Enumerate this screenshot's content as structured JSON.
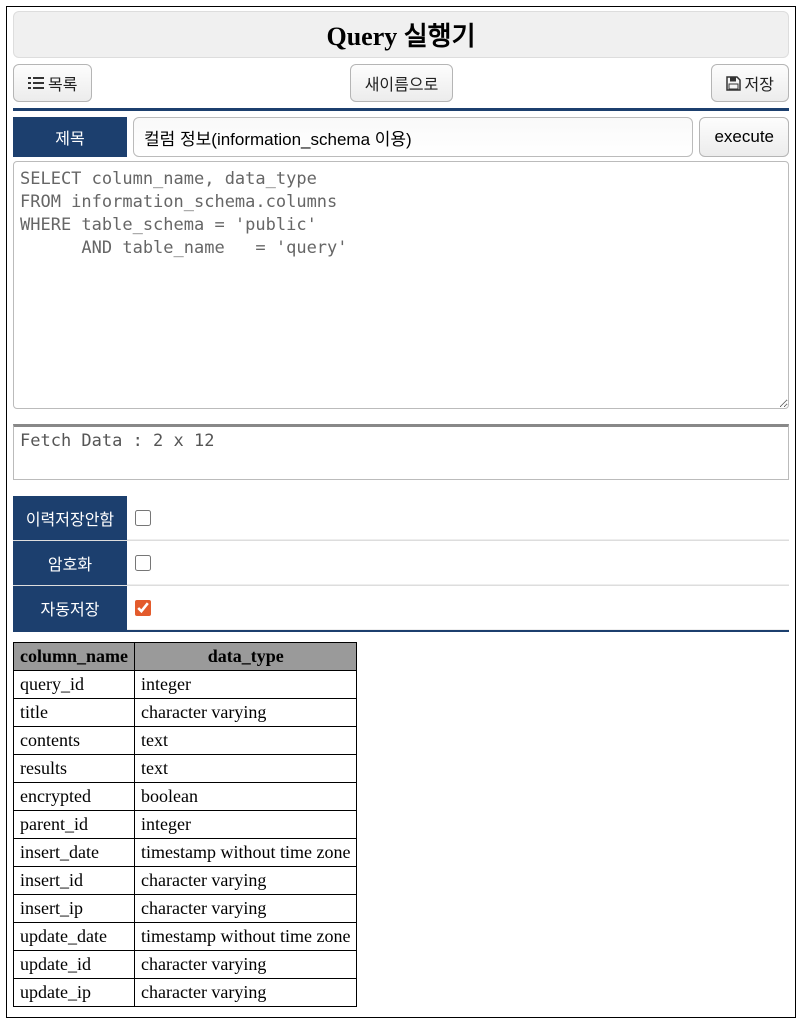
{
  "header": {
    "title": "Query 실행기"
  },
  "toolbar": {
    "list_label": "목록",
    "saveas_label": "새이름으로",
    "save_label": "저장"
  },
  "title_row": {
    "label": "제목",
    "value": "컬럼 정보(information_schema 이용)",
    "execute_label": "execute"
  },
  "query": "SELECT column_name, data_type\nFROM information_schema.columns\nWHERE table_schema = 'public'\n      AND table_name   = 'query'",
  "status": "Fetch Data : 2 x 12",
  "options": {
    "no_history": {
      "label": "이력저장안함",
      "checked": false
    },
    "encrypt": {
      "label": "암호화",
      "checked": false
    },
    "autosave": {
      "label": "자동저장",
      "checked": true
    }
  },
  "result": {
    "headers": [
      "column_name",
      "data_type"
    ],
    "rows": [
      [
        "query_id",
        "integer"
      ],
      [
        "title",
        "character varying"
      ],
      [
        "contents",
        "text"
      ],
      [
        "results",
        "text"
      ],
      [
        "encrypted",
        "boolean"
      ],
      [
        "parent_id",
        "integer"
      ],
      [
        "insert_date",
        "timestamp without time zone"
      ],
      [
        "insert_id",
        "character varying"
      ],
      [
        "insert_ip",
        "character varying"
      ],
      [
        "update_date",
        "timestamp without time zone"
      ],
      [
        "update_id",
        "character varying"
      ],
      [
        "update_ip",
        "character varying"
      ]
    ]
  }
}
